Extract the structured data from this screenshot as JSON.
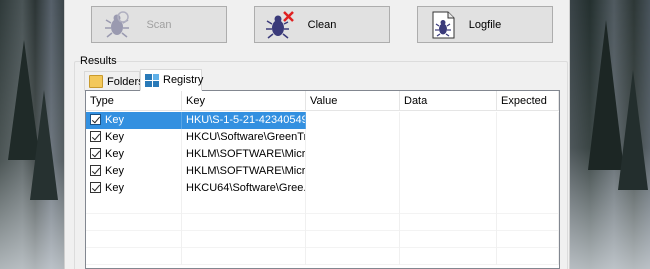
{
  "toolbar": {
    "scan_label": "Scan",
    "clean_label": "Clean",
    "logfile_label": "Logfile"
  },
  "results": {
    "group_label": "Results",
    "tabs": [
      {
        "label": "Folders",
        "icon": "folder-icon"
      },
      {
        "label": "Registry",
        "icon": "registry-icon"
      }
    ],
    "active_tab": "Registry"
  },
  "table": {
    "columns": [
      "Type",
      "Key",
      "Value",
      "Data",
      "Expected"
    ],
    "rows": [
      {
        "checked": true,
        "type": "Key",
        "key": "HKU\\S-1-5-21-42340549...",
        "value": "",
        "data": "",
        "expected": "",
        "selected": true
      },
      {
        "checked": true,
        "type": "Key",
        "key": "HKCU\\Software\\GreenTr...",
        "value": "",
        "data": "",
        "expected": "",
        "selected": false
      },
      {
        "checked": true,
        "type": "Key",
        "key": "HKLM\\SOFTWARE\\Micr...",
        "value": "",
        "data": "",
        "expected": "",
        "selected": false
      },
      {
        "checked": true,
        "type": "Key",
        "key": "HKLM\\SOFTWARE\\Micr...",
        "value": "",
        "data": "",
        "expected": "",
        "selected": false
      },
      {
        "checked": true,
        "type": "Key",
        "key": "HKCU64\\Software\\Gree...",
        "value": "",
        "data": "",
        "expected": "",
        "selected": false
      }
    ]
  },
  "colors": {
    "selection": "#3390e0",
    "window_bg": "#f0f0f0",
    "button_bg": "#e1e1e1"
  }
}
